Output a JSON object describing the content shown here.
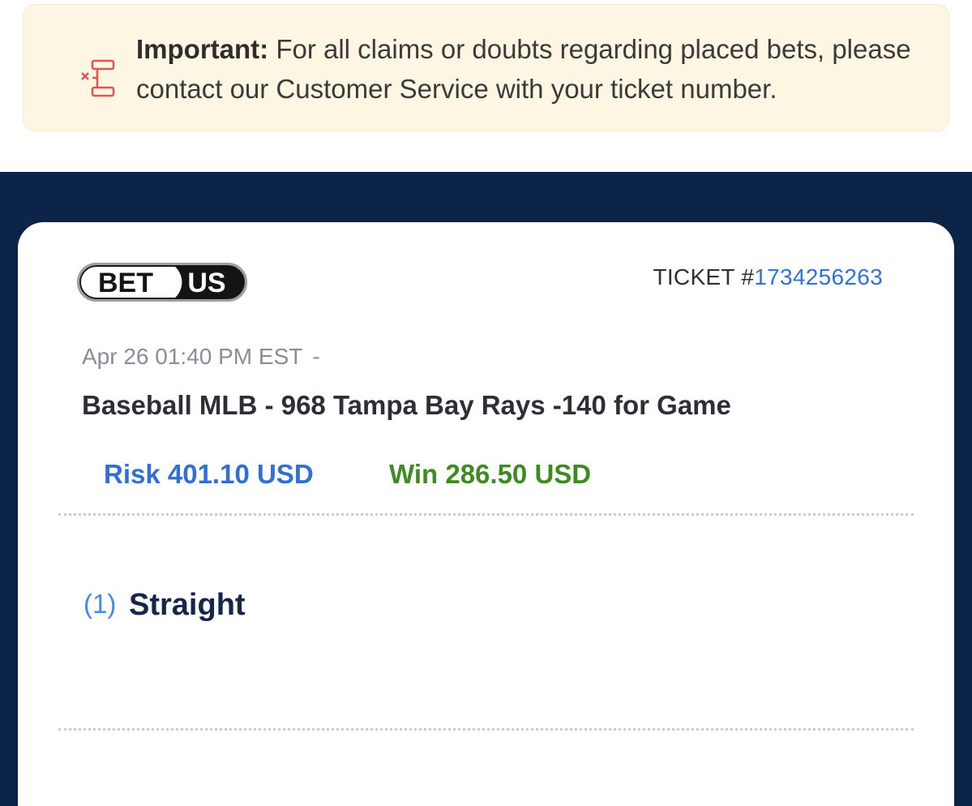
{
  "notice": {
    "icon": "bet-slip-icon",
    "important_label": "Important:",
    "message": " For all claims or doubts regarding placed bets, please contact our Customer Service with your ticket number."
  },
  "ticket": {
    "brand": {
      "part1": "BET",
      "part2": "US"
    },
    "label": "TICKET #",
    "number": "1734256263",
    "datetime": "Apr 26 01:40 PM EST",
    "datetime_separator": "-",
    "description": "Baseball MLB - 968 Tampa Bay Rays -140 for Game",
    "risk": "Risk 401.10 USD",
    "win": "Win 286.50 USD",
    "bet_index": "(1)",
    "bet_type": "Straight"
  },
  "colors": {
    "navy_background": "#0b2447",
    "notice_background": "#fdf6e3",
    "link_blue": "#2f73d8",
    "win_green": "#3e8b22",
    "icon_red": "#e0554f"
  }
}
